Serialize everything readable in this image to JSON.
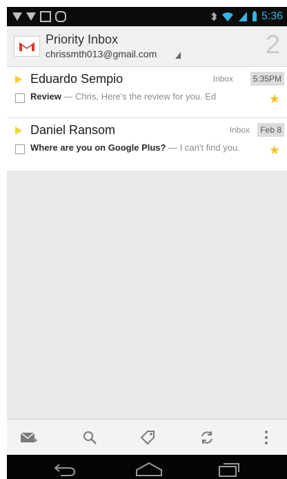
{
  "status": {
    "time": "5:36"
  },
  "header": {
    "title": "Priority Inbox",
    "account": "chrissmth013@gmail.com",
    "count": "2"
  },
  "messages": [
    {
      "sender": "Eduardo Sempio",
      "label": "Inbox",
      "time": "5:35PM",
      "subject": "Review",
      "snippet": " — Chris, Here's the review for you. Ed",
      "starred": true
    },
    {
      "sender": "Daniel Ransom",
      "label": "Inbox",
      "time": "Feb 8",
      "subject": "Where are you on Google Plus?",
      "snippet": " — I can't find you.",
      "starred": true
    }
  ],
  "toolbar": {
    "icons": [
      "compose-icon",
      "search-icon",
      "label-icon",
      "refresh-icon",
      "overflow-menu-icon"
    ]
  },
  "nav": {
    "icons": [
      "back-icon",
      "home-icon",
      "recents-icon"
    ]
  },
  "colors": {
    "time_accent": "#33b5e5",
    "important_marker": "#f4d23a",
    "star": "#f2c224"
  }
}
